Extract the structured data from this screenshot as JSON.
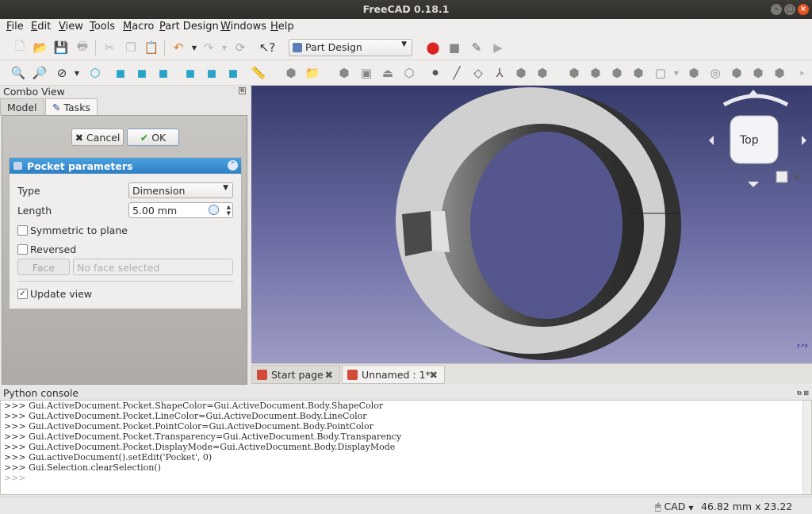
{
  "window": {
    "title": "FreeCAD 0.18.1"
  },
  "menu": [
    "File",
    "Edit",
    "View",
    "Tools",
    "Macro",
    "Part Design",
    "Windows",
    "Help"
  ],
  "toolbar": {
    "workbench": "Part Design"
  },
  "combo_view": {
    "title": "Combo View",
    "tabs": [
      "Model",
      "Tasks"
    ],
    "cancel_label": "Cancel",
    "ok_label": "OK"
  },
  "pocket": {
    "header": "Pocket parameters",
    "type_label": "Type",
    "type_value": "Dimension",
    "length_label": "Length",
    "length_value": "5.00 mm",
    "symmetric_label": "Symmetric to plane",
    "symmetric_checked": false,
    "reversed_label": "Reversed",
    "reversed_checked": false,
    "face_button": "Face",
    "face_placeholder": "No face selected",
    "update_label": "Update view",
    "update_checked": true
  },
  "navcube": {
    "face": "Top"
  },
  "doc_tabs": [
    {
      "label": "Start page"
    },
    {
      "label": "Unnamed : 1*"
    }
  ],
  "console": {
    "title": "Python console",
    "lines": [
      ">>> Gui.ActiveDocument.Pocket.ShapeColor=Gui.ActiveDocument.Body.ShapeColor",
      ">>> Gui.ActiveDocument.Pocket.LineColor=Gui.ActiveDocument.Body.LineColor",
      ">>> Gui.ActiveDocument.Pocket.PointColor=Gui.ActiveDocument.Body.PointColor",
      ">>> Gui.ActiveDocument.Pocket.Transparency=Gui.ActiveDocument.Body.Transparency",
      ">>> Gui.ActiveDocument.Pocket.DisplayMode=Gui.ActiveDocument.Body.DisplayMode",
      ">>> Gui.activeDocument().setEdit('Pocket', 0)",
      ">>> Gui.Selection.clearSelection()",
      ">>> "
    ]
  },
  "status": {
    "nav_style": "CAD",
    "dimensions": "46.82 mm x 23.22 mm"
  },
  "colors": {
    "title_bar": "#2f2e2b",
    "panel_header": "#3a8fd4",
    "close_button": "#e95420",
    "view_top": "#353b6a",
    "view_bottom": "#9e9cc5"
  }
}
